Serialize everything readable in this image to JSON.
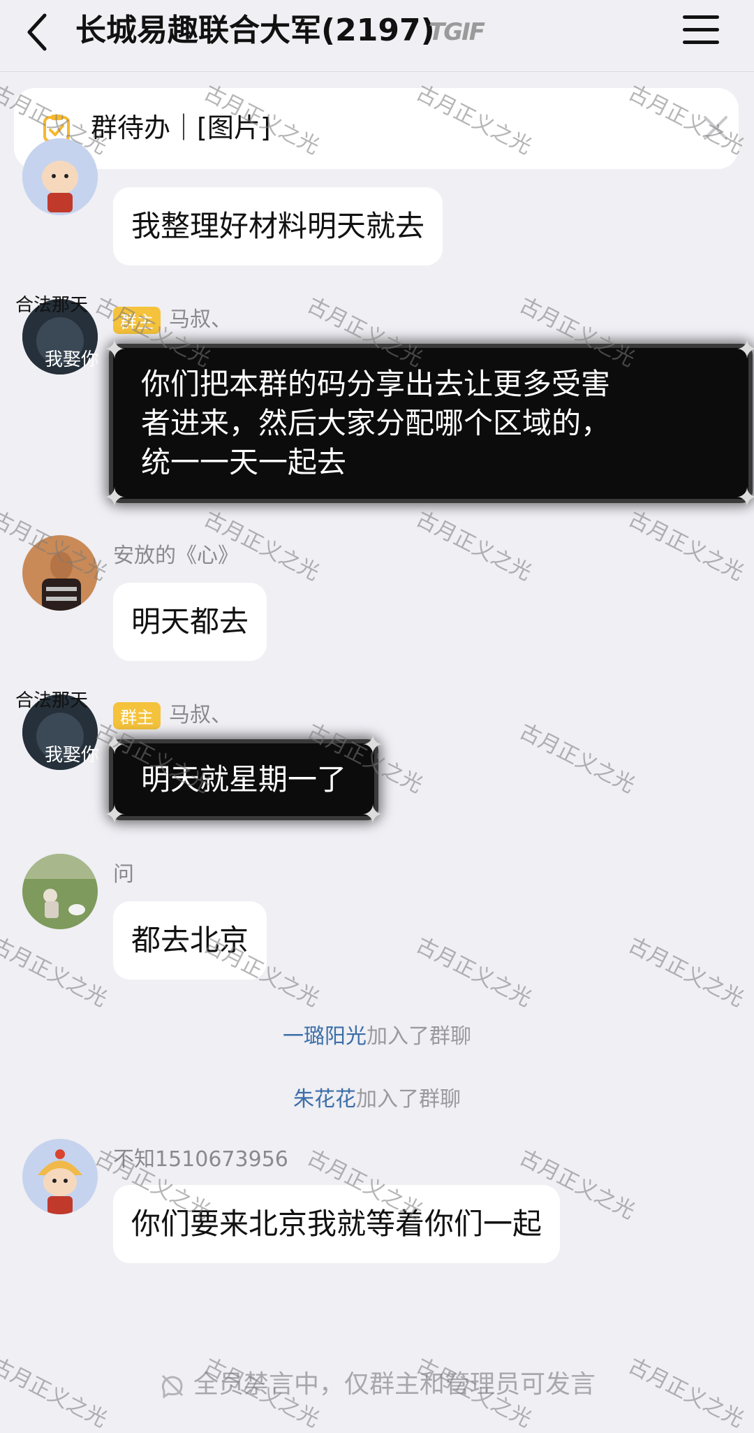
{
  "header": {
    "title": "长城易趣联合大军(2197)",
    "logo_text": "TGIF"
  },
  "todo_banner": {
    "text": "群待办｜[图片]"
  },
  "messages": [
    {
      "sender": "",
      "badge": "",
      "text": "我整理好材料明天就去"
    },
    {
      "sender": "马叔、",
      "badge": "群主",
      "text": "你们把本群的码分享出去让更多受害者进来，然后大家分配哪个区域的，统一一天一起去",
      "lines": [
        "你们把本群的码分享出去让更多受害",
        "者进来，然后大家分配哪个区域的，",
        "统一一天一起去"
      ]
    },
    {
      "sender": "安放的《心》",
      "badge": "",
      "text": "明天都去"
    },
    {
      "sender": "马叔、",
      "badge": "群主",
      "text": "明天就星期一了"
    },
    {
      "sender": "问",
      "badge": "",
      "text": "都去北京"
    },
    {
      "sender": "不知1510673956",
      "badge": "",
      "text": "你们要来北京我就等着你们一起"
    }
  ],
  "system_messages": [
    {
      "name": "一璐阳光",
      "action": "加入了群聊"
    },
    {
      "name": "朱花花",
      "action": "加入了群聊"
    }
  ],
  "bottom": {
    "notice": "全员禁言中，仅群主和管理员可发言"
  },
  "watermark": "古月正义之光",
  "avatar_overlay_text": {
    "top": "合法那天",
    "bottom": "我娶你"
  },
  "colors": {
    "background": "#efeff4",
    "badge": "#f5c23b",
    "link_name": "#3c6ea8"
  }
}
